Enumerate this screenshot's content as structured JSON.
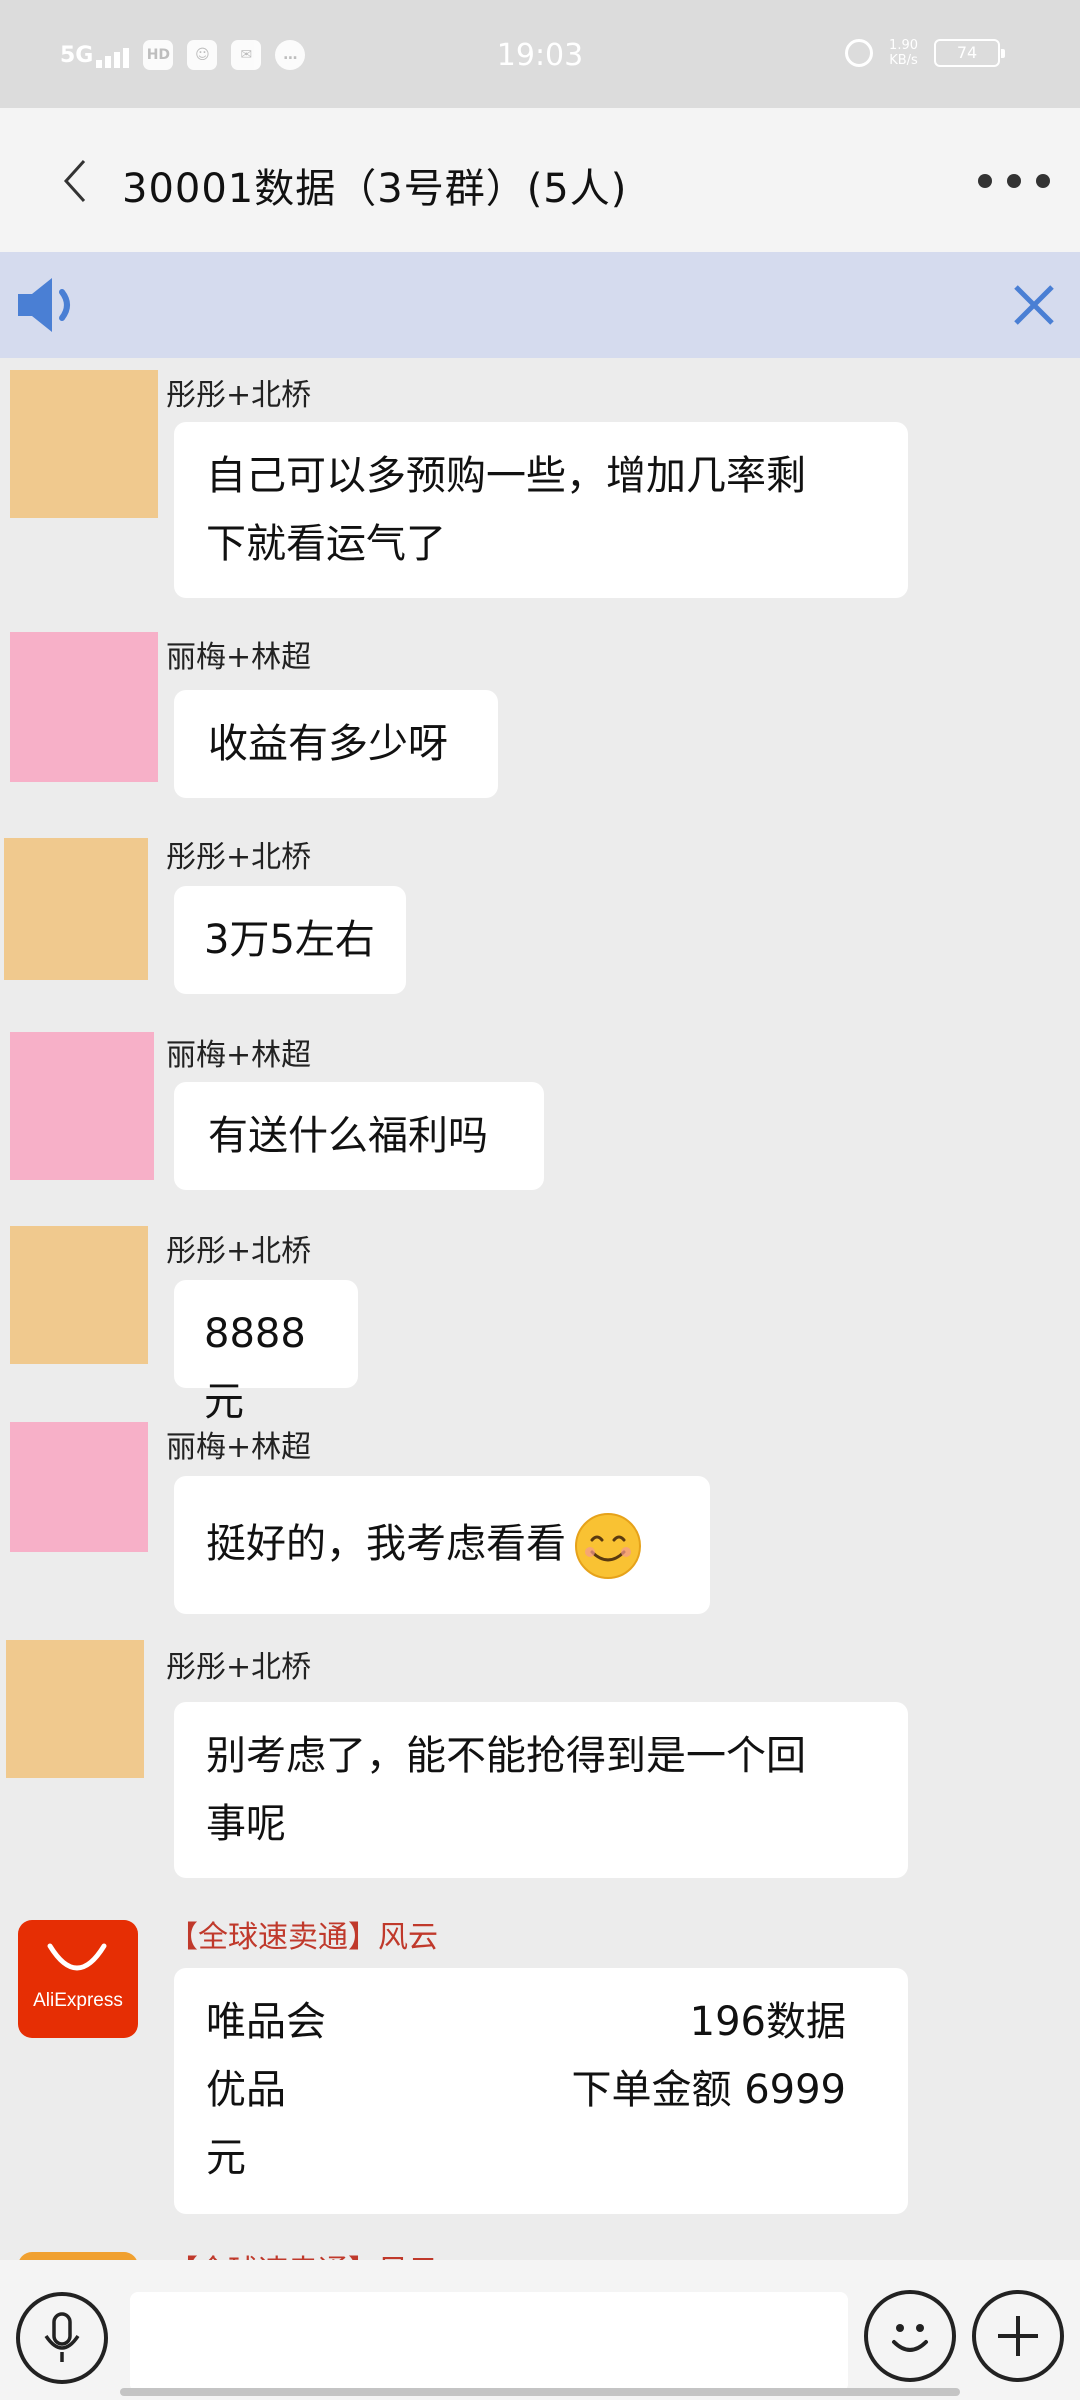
{
  "status_bar": {
    "network": "5G",
    "hd_label": "HD",
    "time": "19:03",
    "net_speed_value": "1.90",
    "net_speed_unit": "KB/s",
    "battery": "74"
  },
  "header": {
    "back_icon": "chevron-left-icon",
    "title": "30001数据（3号群）(5人)",
    "more_icon": "more-dots-icon"
  },
  "notice": {
    "speaker_icon": "speaker-icon",
    "close_icon": "close-icon"
  },
  "colors": {
    "avatar_peach": "#f0c98e",
    "avatar_pink": "#f7b0c8",
    "aliexpress_red": "#e62e04",
    "notice_bg": "#d5dbee",
    "highlight_name": "#c0392b"
  },
  "messages": [
    {
      "sender": "彤彤+北桥",
      "lines": [
        "自己可以多预购一些，增加几率剩",
        "下就看运气了"
      ]
    },
    {
      "sender": "丽梅+林超",
      "lines": [
        "收益有多少呀"
      ]
    },
    {
      "sender": "彤彤+北桥",
      "lines": [
        "3万5左右"
      ]
    },
    {
      "sender": "丽梅+林超",
      "lines": [
        "有送什么福利吗"
      ]
    },
    {
      "sender": "彤彤+北桥",
      "lines": [
        "8888元"
      ]
    },
    {
      "sender": "丽梅+林超",
      "lines": [
        "挺好的，我考虑看看"
      ],
      "emoji": "smiling-face-emoji"
    },
    {
      "sender": "彤彤+北桥",
      "lines": [
        "别考虑了，能不能抢得到是一个回",
        "事呢"
      ]
    },
    {
      "sender": "【全球速卖通】风云",
      "avatar_label": "AliExpress",
      "rows": [
        {
          "left": "唯品会",
          "right": "196数据"
        },
        {
          "left": "优品",
          "right": "下单金额 6999"
        },
        {
          "left": "元",
          "right": ""
        }
      ]
    },
    {
      "sender": "【全球速卖通】风云",
      "partial": true
    }
  ],
  "input_bar": {
    "voice_icon": "microphone-icon",
    "emoji_icon": "smiley-icon",
    "plus_icon": "plus-icon"
  }
}
